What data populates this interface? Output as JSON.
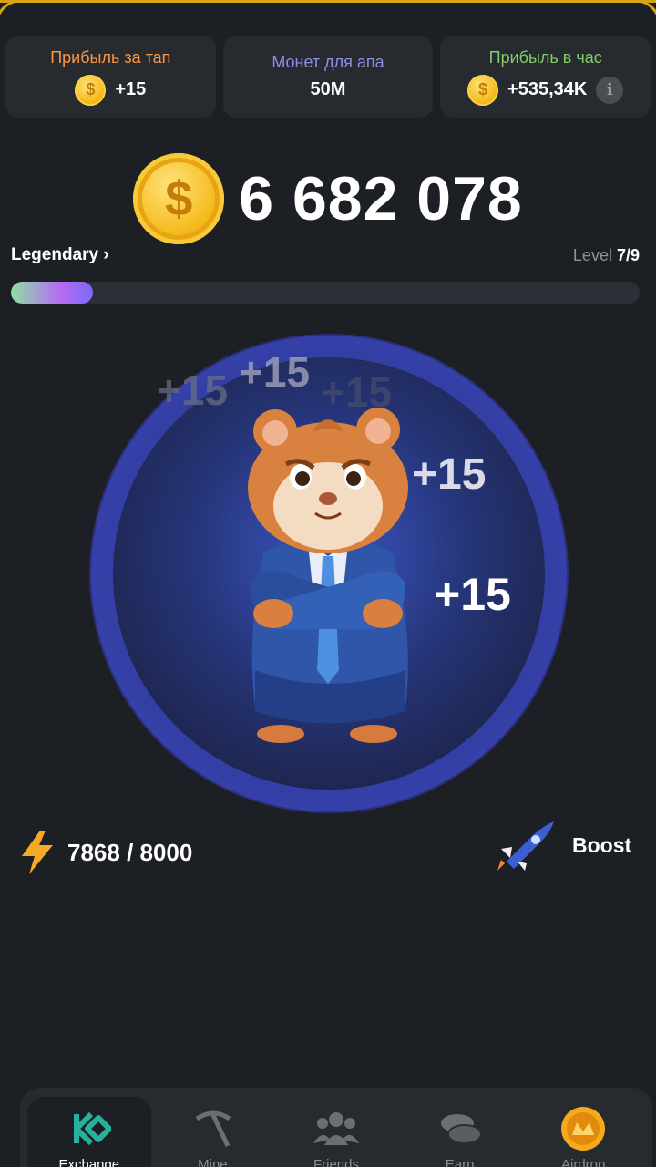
{
  "stats": [
    {
      "label": "Прибыль за тап",
      "value": "+15",
      "icon": "coin-icon",
      "color": "#f79841"
    },
    {
      "label": "Монет для апа",
      "value": "50M",
      "color": "#8c8fe6"
    },
    {
      "label": "Прибыль в час",
      "value": "+535,34K",
      "icon": "coin-icon",
      "color": "#84cb69"
    }
  ],
  "balance": "6 682 078",
  "level": {
    "name": "Legendary",
    "chevron": "›",
    "prefix": "Level",
    "value": "7/9",
    "progress_fraction": 0.13
  },
  "tap_floats": [
    "+15",
    "+15",
    "+15",
    "+15",
    "+15"
  ],
  "energy": {
    "text": "7868 / 8000",
    "icon": "lightning-icon"
  },
  "boost": {
    "label": "Boost",
    "icon": "rocket-icon"
  },
  "nav": [
    {
      "label": "Exchange",
      "icon": "exchange-icon",
      "active": true
    },
    {
      "label": "Mine",
      "icon": "pickaxe-icon",
      "active": false
    },
    {
      "label": "Friends",
      "icon": "friends-icon",
      "active": false
    },
    {
      "label": "Earn",
      "icon": "coins-icon",
      "active": false
    },
    {
      "label": "Airdrop",
      "icon": "airdrop-icon",
      "active": false
    }
  ],
  "colors": {
    "accent_gold": "#f5bb1d",
    "background": "#1c1f24",
    "card": "#272a2f",
    "tap_blue": "#3a4bb5"
  }
}
